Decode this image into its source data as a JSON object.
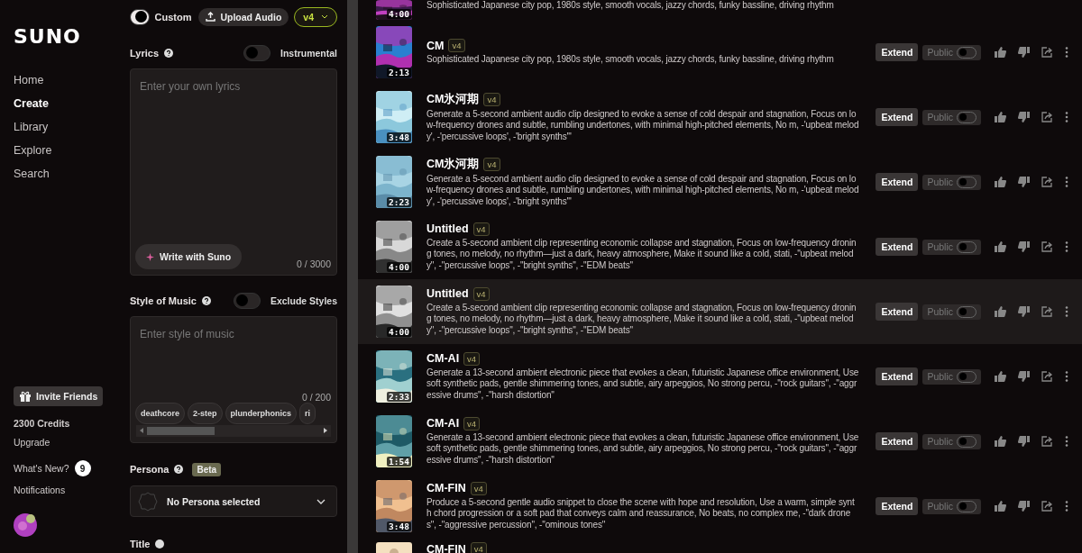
{
  "sidebar": {
    "logo": "SUNO",
    "nav": [
      {
        "label": "Home",
        "selected": false
      },
      {
        "label": "Create",
        "selected": true
      },
      {
        "label": "Library",
        "selected": false
      },
      {
        "label": "Explore",
        "selected": false
      },
      {
        "label": "Search",
        "selected": false
      }
    ],
    "invite": "Invite Friends",
    "credits": "2300 Credits",
    "upgrade": "Upgrade",
    "whats_new": "What's New?",
    "whats_new_count": "9",
    "notifications": "Notifications"
  },
  "create": {
    "custom": {
      "label": "Custom",
      "on": true
    },
    "upload": "Upload Audio",
    "model": "v4",
    "lyrics": {
      "label": "Lyrics",
      "toggle": {
        "label": "Instrumental",
        "on": false
      },
      "placeholder": "Enter your own lyrics",
      "write_button": "Write with Suno",
      "counter": "0 / 3000"
    },
    "style": {
      "label": "Style of Music",
      "toggle": {
        "label": "Exclude Styles",
        "on": false
      },
      "placeholder": "Enter style of music",
      "counter": "0 / 200",
      "chips": [
        "deathcore",
        "2-step",
        "plunderphonics",
        "ri"
      ]
    },
    "persona": {
      "label": "Persona",
      "badge": "Beta",
      "value": "No Persona selected"
    },
    "title_label": "Title"
  },
  "songs": [
    {
      "kind": "cut",
      "duration": "4:00",
      "description": "Sophisticated Japanese city pop, 1980s style, smooth vocals, jazzy chords, funky bassline, driving rhythm",
      "selected": false
    },
    {
      "kind": "full",
      "title": "CM",
      "version": "v4",
      "duration": "2:13",
      "description": "Sophisticated Japanese city pop, 1980s style, smooth vocals, jazzy chords, funky bassline, driving rhythm",
      "extend": "Extend",
      "public_label": "Public",
      "public": false,
      "selected": false
    },
    {
      "kind": "full",
      "title": "CM氷河期",
      "version": "v4",
      "duration": "3:48",
      "description": "Generate a 5-second ambient audio clip designed to evoke a sense of cold despair and stagnation, Focus on low-frequency drones and subtle, rumbling undertones, with minimal high-pitched elements, No m, -'upbeat melody', -'percussive loops', -'bright synths'\"",
      "extend": "Extend",
      "public_label": "Public",
      "public": false,
      "selected": false
    },
    {
      "kind": "full",
      "title": "CM氷河期",
      "version": "v4",
      "duration": "2:23",
      "description": "Generate a 5-second ambient audio clip designed to evoke a sense of cold despair and stagnation, Focus on low-frequency drones and subtle, rumbling undertones, with minimal high-pitched elements, No m, -'upbeat melody', -'percussive loops', -'bright synths'\"",
      "extend": "Extend",
      "public_label": "Public",
      "public": false,
      "selected": false
    },
    {
      "kind": "full",
      "title": "Untitled",
      "version": "v4",
      "duration": "4:00",
      "description": "Create a 5-second ambient clip representing economic collapse and stagnation, Focus on low-frequency droning tones, no melody, no rhythm—just a dark, heavy atmosphere, Make it sound like a cold, stati, -\"upbeat melody\", -\"percussive loops\", -\"bright synths\", -\"EDM beats\"",
      "extend": "Extend",
      "public_label": "Public",
      "public": false,
      "selected": false
    },
    {
      "kind": "full",
      "title": "Untitled",
      "version": "v4",
      "duration": "4:00",
      "description": "Create a 5-second ambient clip representing economic collapse and stagnation, Focus on low-frequency droning tones, no melody, no rhythm—just a dark, heavy atmosphere, Make it sound like a cold, stati, -\"upbeat melody\", -\"percussive loops\", -\"bright synths\", -\"EDM beats\"",
      "extend": "Extend",
      "public_label": "Public",
      "public": false,
      "selected": true
    },
    {
      "kind": "full",
      "title": "CM-AI",
      "version": "v4",
      "duration": "2:33",
      "description": "Generate a 13-second ambient electronic piece that evokes a clean, futuristic Japanese office environment, Use soft synthetic pads, gentle shimmering tones, and subtle, airy arpeggios, No strong percu, -\"rock guitars\", -\"aggressive drums\", -\"harsh distortion\"",
      "extend": "Extend",
      "public_label": "Public",
      "public": false,
      "selected": false
    },
    {
      "kind": "full",
      "title": "CM-AI",
      "version": "v4",
      "duration": "1:54",
      "description": "Generate a 13-second ambient electronic piece that evokes a clean, futuristic Japanese office environment, Use soft synthetic pads, gentle shimmering tones, and subtle, airy arpeggios, No strong percu, -\"rock guitars\", -\"aggressive drums\", -\"harsh distortion\"",
      "extend": "Extend",
      "public_label": "Public",
      "public": false,
      "selected": false
    },
    {
      "kind": "full",
      "title": "CM-FIN",
      "version": "v4",
      "duration": "3:48",
      "description": "Produce a 5-second gentle audio snippet to close the scene with hope and resolution, Use a warm, simple synth chord progression or a soft pad that conveys calm and reassurance, No beats, no complex me, -\"dark drones\", -\"aggressive percussion\", -\"ominous tones\"",
      "extend": "Extend",
      "public_label": "Public",
      "public": false,
      "selected": false
    },
    {
      "kind": "title_only",
      "title": "CM-FIN",
      "version": "v4",
      "selected": false
    }
  ]
}
